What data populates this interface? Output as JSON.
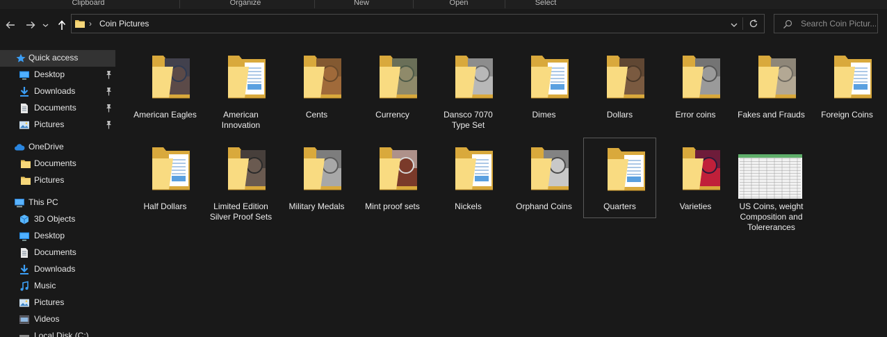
{
  "ribbon": {
    "groups": [
      "Clipboard",
      "Organize",
      "New",
      "Open",
      "Select"
    ]
  },
  "address": {
    "path": "Coin Pictures",
    "separator": "›"
  },
  "search": {
    "placeholder": "Search Coin Pictur..."
  },
  "sidebar": {
    "items": [
      {
        "label": "Quick access",
        "icon": "star-icon"
      },
      {
        "label": "Desktop",
        "icon": "desktop-icon"
      },
      {
        "label": "Downloads",
        "icon": "download-icon"
      },
      {
        "label": "Documents",
        "icon": "documents-icon"
      },
      {
        "label": "Pictures",
        "icon": "pictures-icon"
      },
      {
        "label": "OneDrive",
        "icon": "cloud-icon"
      },
      {
        "label": "Documents",
        "icon": "folder-icon"
      },
      {
        "label": "Pictures",
        "icon": "folder-icon"
      },
      {
        "label": "This PC",
        "icon": "computer-icon"
      },
      {
        "label": "3D Objects",
        "icon": "cube-icon"
      },
      {
        "label": "Desktop",
        "icon": "desktop-icon"
      },
      {
        "label": "Documents",
        "icon": "documents-icon"
      },
      {
        "label": "Downloads",
        "icon": "download-icon"
      },
      {
        "label": "Music",
        "icon": "music-icon"
      },
      {
        "label": "Pictures",
        "icon": "pictures-icon"
      },
      {
        "label": "Videos",
        "icon": "videos-icon"
      },
      {
        "label": "Local Disk (C:)",
        "icon": "drive-icon"
      }
    ]
  },
  "folders": [
    {
      "label": "American Eagles",
      "kind": "photo",
      "c1": "#5b4a48",
      "c2": "#2e3a52"
    },
    {
      "label": "American\nInnovation",
      "kind": "doc"
    },
    {
      "label": "Cents",
      "kind": "photo",
      "c1": "#a06a3a",
      "c2": "#6b4a2a"
    },
    {
      "label": "Currency",
      "kind": "photo",
      "c1": "#8f8a6a",
      "c2": "#4d5a48"
    },
    {
      "label": "Dansco 7070\nType Set",
      "kind": "photo",
      "c1": "#b8b8b8",
      "c2": "#6a6a6a"
    },
    {
      "label": "Dimes",
      "kind": "doc"
    },
    {
      "label": "Dollars",
      "kind": "photo",
      "c1": "#7a5a40",
      "c2": "#4a3828"
    },
    {
      "label": "Error coins",
      "kind": "photo",
      "c1": "#9a9a9a",
      "c2": "#555555"
    },
    {
      "label": "Fakes and Frauds",
      "kind": "photo",
      "c1": "#b3a894",
      "c2": "#6f6a60"
    },
    {
      "label": "Foreign Coins",
      "kind": "doc"
    },
    {
      "label": "Half Dollars",
      "kind": "doc"
    },
    {
      "label": "Limited Edition\nSilver Proof Sets",
      "kind": "photo",
      "c1": "#6a5a50",
      "c2": "#2a2a2a"
    },
    {
      "label": "Military Medals",
      "kind": "photo",
      "c1": "#a8a8a8",
      "c2": "#5a5a5a"
    },
    {
      "label": "Mint proof sets",
      "kind": "photo",
      "c1": "#7a3a2a",
      "c2": "#d8d8d8"
    },
    {
      "label": "Nickels",
      "kind": "doc"
    },
    {
      "label": "Orphand Coins",
      "kind": "photo",
      "c1": "#c8c8c8",
      "c2": "#4a4a4a"
    },
    {
      "label": "Quarters",
      "kind": "doc"
    },
    {
      "label": "Varieties",
      "kind": "photo",
      "c1": "#c0203a",
      "c2": "#2a1a3a"
    },
    {
      "label": "US Coins, weight\nComposition and\nTolererances",
      "kind": "sheet"
    }
  ],
  "selected_folder": "Quarters"
}
